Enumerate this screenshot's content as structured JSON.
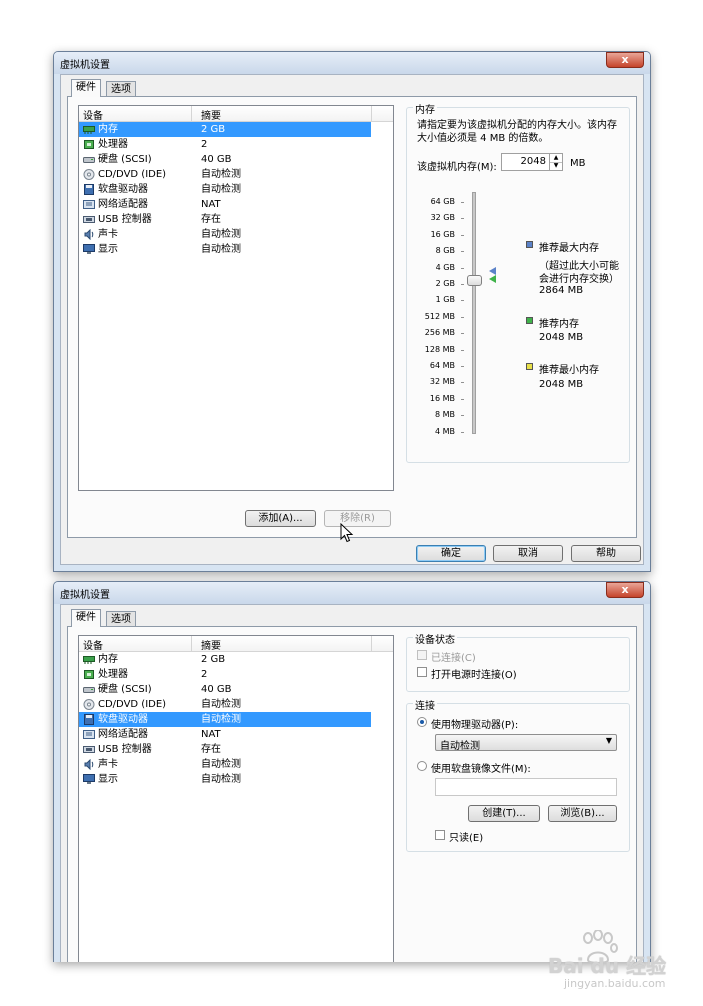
{
  "dialog1": {
    "title": "虚拟机设置",
    "close": "x",
    "tabs": [
      "硬件",
      "选项"
    ],
    "list": {
      "col_device": "设备",
      "col_summary": "摘要",
      "rows": [
        {
          "device": "内存",
          "summary": "2 GB",
          "icon": "memory-icon",
          "selected": true
        },
        {
          "device": "处理器",
          "summary": "2",
          "icon": "processor-icon",
          "selected": false
        },
        {
          "device": "硬盘 (SCSI)",
          "summary": "40 GB",
          "icon": "harddisk-icon",
          "selected": false
        },
        {
          "device": "CD/DVD (IDE)",
          "summary": "自动检测",
          "icon": "cd-dvd-icon",
          "selected": false
        },
        {
          "device": "软盘驱动器",
          "summary": "自动检测",
          "icon": "floppy-icon",
          "selected": false
        },
        {
          "device": "网络适配器",
          "summary": "NAT",
          "icon": "network-adapter-icon",
          "selected": false
        },
        {
          "device": "USB 控制器",
          "summary": "存在",
          "icon": "usb-icon",
          "selected": false
        },
        {
          "device": "声卡",
          "summary": "自动检测",
          "icon": "sound-card-icon",
          "selected": false
        },
        {
          "device": "显示",
          "summary": "自动检测",
          "icon": "display-icon",
          "selected": false
        }
      ]
    },
    "add_button": "添加(A)...",
    "remove_button": "移除(R)",
    "memory": {
      "group_title": "内存",
      "description_line1": "请指定要为该虚拟机分配的内存大小。该内存",
      "description_line2": "大小值必须是 4 MB 的倍数。",
      "field_label": "该虚拟机内存(M):",
      "field_value": "2048",
      "unit": "MB",
      "scale": [
        "64 GB",
        "32 GB",
        "16 GB",
        "8 GB",
        "4 GB",
        "2 GB",
        "1 GB",
        "512 MB",
        "256 MB",
        "128 MB",
        "64 MB",
        "32 MB",
        "16 MB",
        "8 MB",
        "4 MB"
      ],
      "slider_value": "2 GB",
      "max_title": "推荐最大内存",
      "max_note1": "（超过此大小可能",
      "max_note2": "会进行内存交换）",
      "max_value": "2864 MB",
      "rec_title": "推荐内存",
      "rec_value": "2048 MB",
      "min_title": "推荐最小内存",
      "min_value": "2048 MB",
      "colors": {
        "max": "#5b82c8",
        "rec": "#3fb24a",
        "min": "#e8e04a"
      }
    },
    "ok_button": "确定",
    "cancel_button": "取消",
    "help_button": "帮助"
  },
  "dialog2": {
    "title": "虚拟机设置",
    "close": "x",
    "tabs": [
      "硬件",
      "选项"
    ],
    "list": {
      "col_device": "设备",
      "col_summary": "摘要",
      "rows": [
        {
          "device": "内存",
          "summary": "2 GB",
          "icon": "memory-icon",
          "selected": false
        },
        {
          "device": "处理器",
          "summary": "2",
          "icon": "processor-icon",
          "selected": false
        },
        {
          "device": "硬盘 (SCSI)",
          "summary": "40 GB",
          "icon": "harddisk-icon",
          "selected": false
        },
        {
          "device": "CD/DVD (IDE)",
          "summary": "自动检测",
          "icon": "cd-dvd-icon",
          "selected": false
        },
        {
          "device": "软盘驱动器",
          "summary": "自动检测",
          "icon": "floppy-icon",
          "selected": true
        },
        {
          "device": "网络适配器",
          "summary": "NAT",
          "icon": "network-adapter-icon",
          "selected": false
        },
        {
          "device": "USB 控制器",
          "summary": "存在",
          "icon": "usb-icon",
          "selected": false
        },
        {
          "device": "声卡",
          "summary": "自动检测",
          "icon": "sound-card-icon",
          "selected": false
        },
        {
          "device": "显示",
          "summary": "自动检测",
          "icon": "display-icon",
          "selected": false
        }
      ]
    },
    "device_status": {
      "group_title": "设备状态",
      "connected": "已连接(C)",
      "connect_at_power_on": "打开电源时连接(O)"
    },
    "connection": {
      "group_title": "连接",
      "use_physical": "使用物理驱动器(P):",
      "physical_value": "自动检测",
      "use_image": "使用软盘镜像文件(M):",
      "image_value": "",
      "create_button": "创建(T)...",
      "browse_button": "浏览(B)...",
      "readonly": "只读(E)"
    }
  },
  "watermark": {
    "brand": "Bai du 经验",
    "url": "jingyan.baidu.com"
  }
}
